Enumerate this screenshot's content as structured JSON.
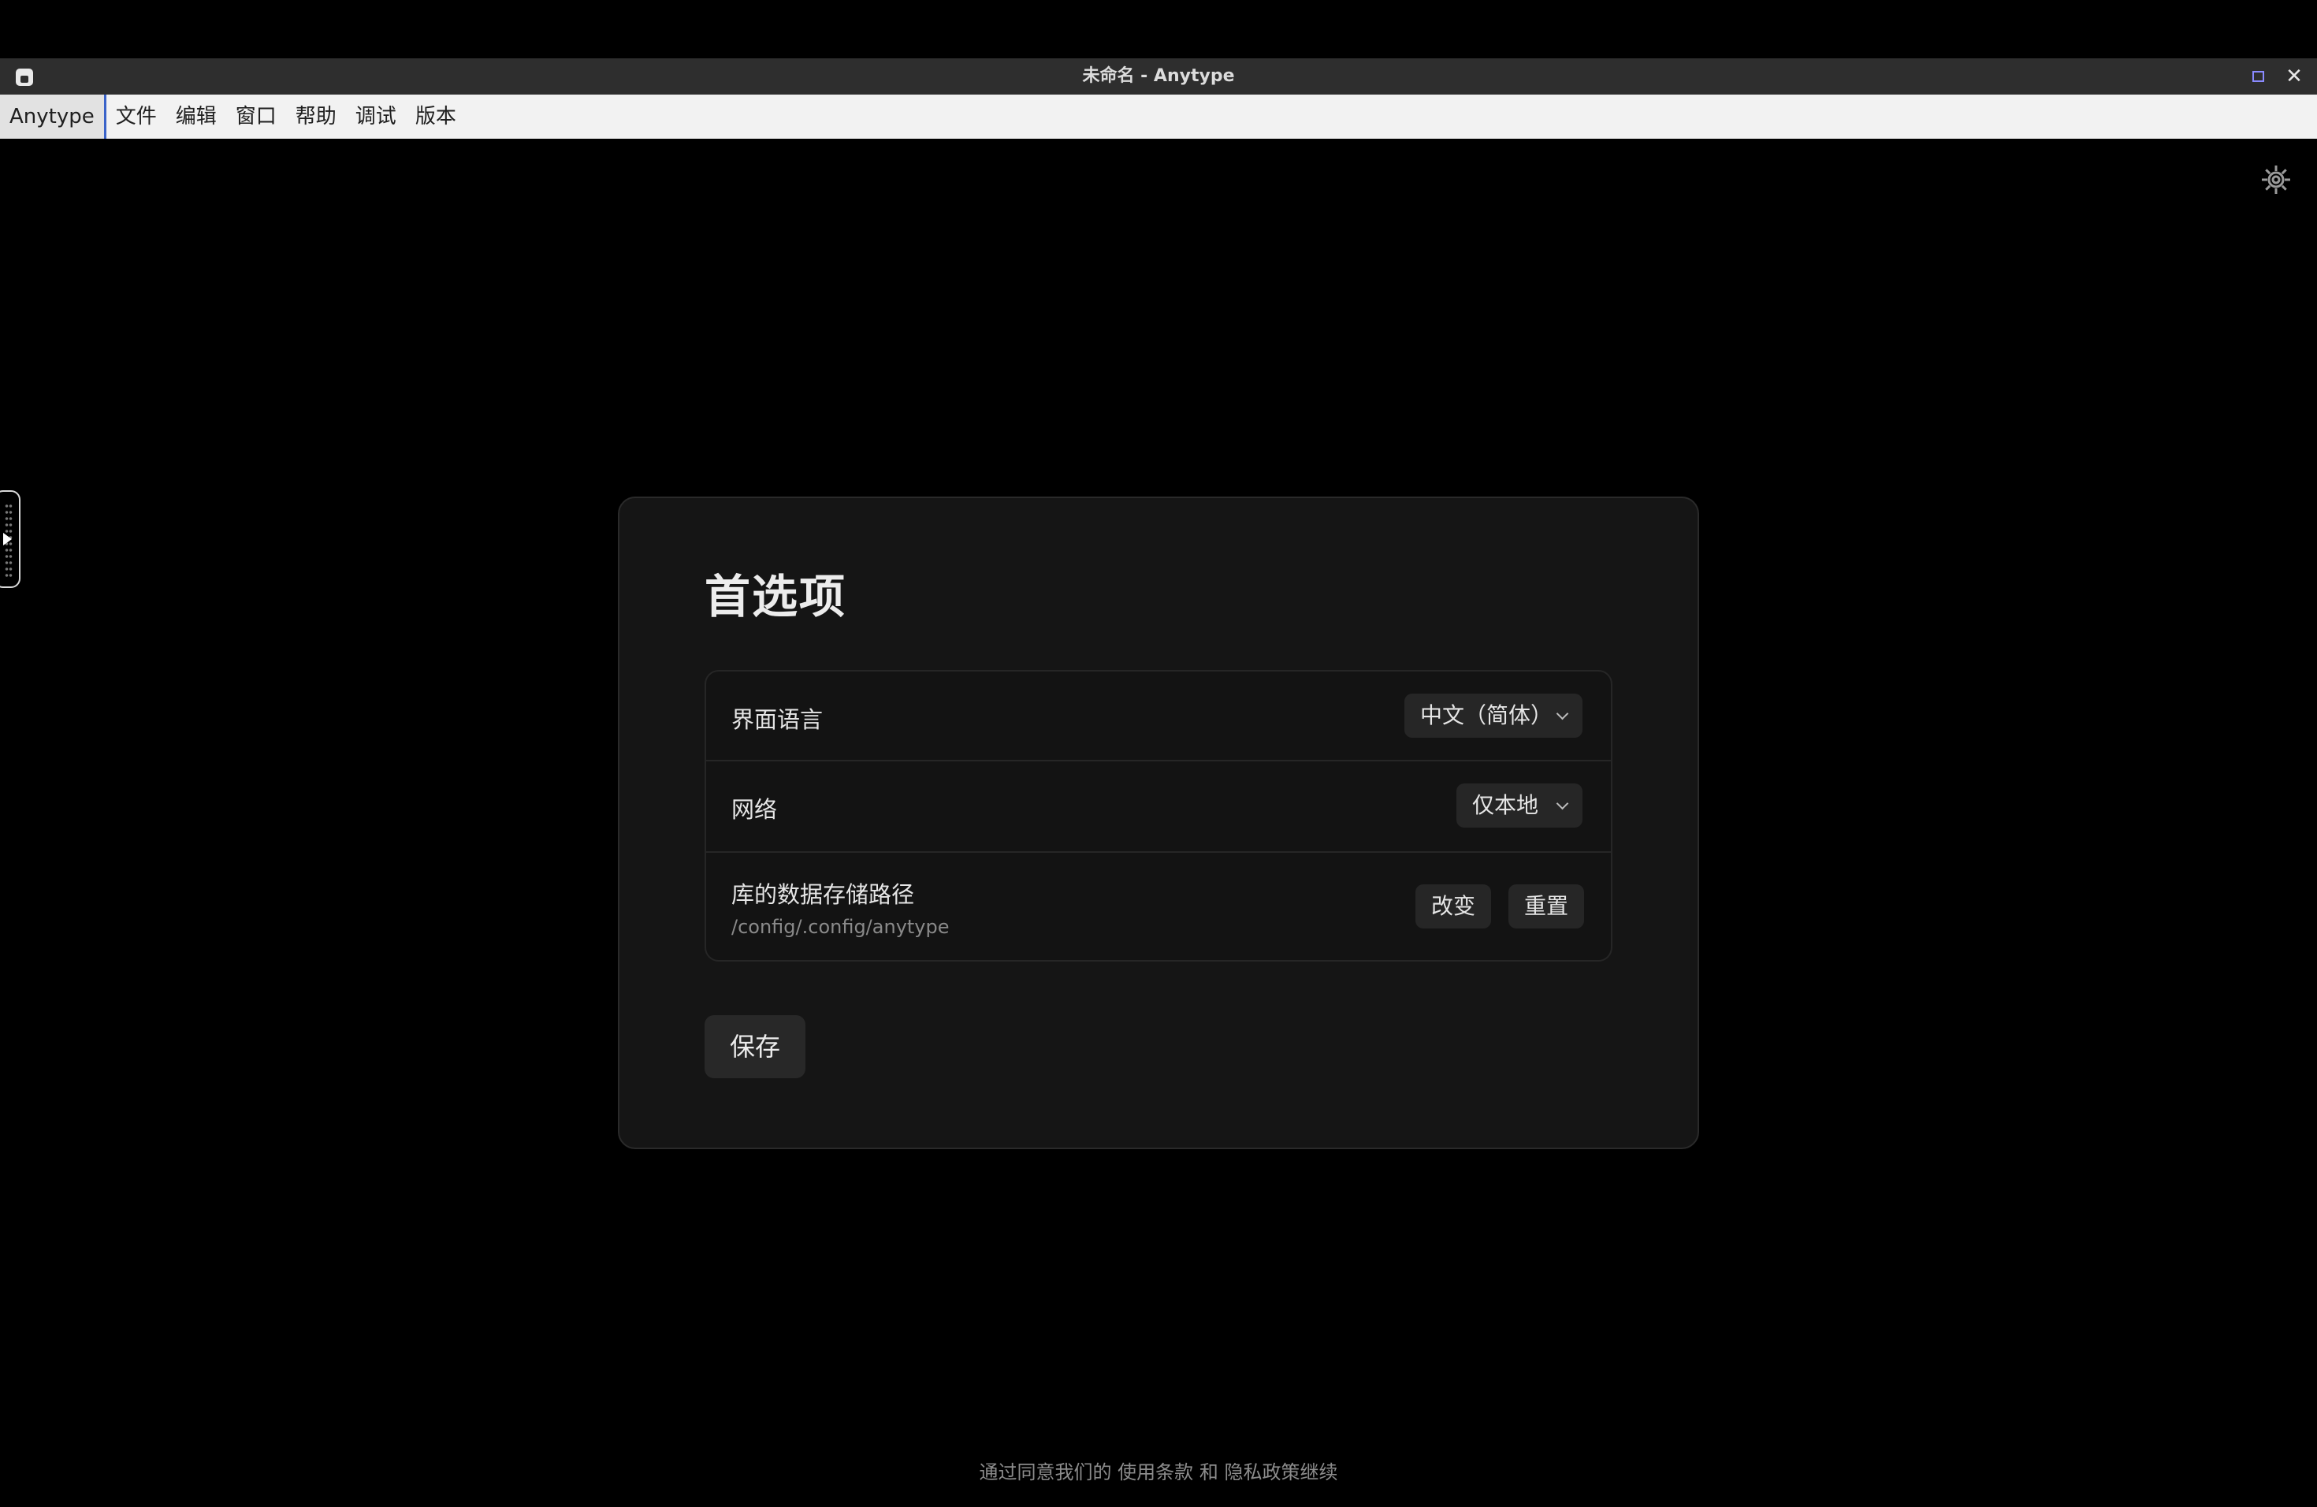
{
  "window": {
    "title": "未命名 - Anytype",
    "close_glyph": "✕",
    "accent_color": "#8a8aff"
  },
  "menubar": {
    "items": [
      {
        "label": "Anytype"
      },
      {
        "label": "文件"
      },
      {
        "label": "编辑"
      },
      {
        "label": "窗口"
      },
      {
        "label": "帮助"
      },
      {
        "label": "调试"
      },
      {
        "label": "版本"
      }
    ]
  },
  "preferences": {
    "title": "首选项",
    "language": {
      "label": "界面语言",
      "value": "中文（简体）"
    },
    "network": {
      "label": "网络",
      "value": "仅本地"
    },
    "storage": {
      "label": "库的数据存储路径",
      "path": "/config/.config/anytype",
      "change_label": "改变",
      "reset_label": "重置"
    },
    "save_label": "保存"
  },
  "footer": {
    "prefix": "通过同意我们的",
    "terms_link": "使用条款",
    "conjunction": "和",
    "privacy_link": "隐私政策",
    "suffix": "继续"
  },
  "icons": {
    "settings": "gear-icon",
    "sidebar_toggle": "arrow-right-icon"
  }
}
